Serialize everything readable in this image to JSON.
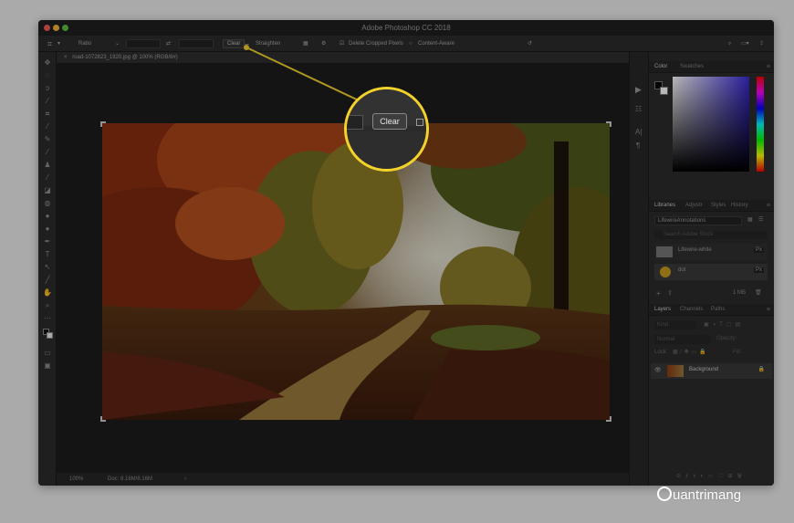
{
  "window": {
    "title": "Adobe Photoshop CC 2018"
  },
  "options_bar": {
    "ratio_label": "Ratio",
    "clear_label": "Clear",
    "straighten_label": "Straighten",
    "delete_cropped_label": "Delete Cropped Pixels",
    "content_aware_label": "Content-Aware"
  },
  "document": {
    "tab_label": "road-1072823_1920.jpg @ 100% (RGB/8#)",
    "zoom": "100%",
    "doc_info": "Doc: 8.16M/8.16M"
  },
  "callout": {
    "clear_label": "Clear",
    "accent_color": "#f3d22b"
  },
  "panels": {
    "color_tabs": [
      "Color",
      "Swatches"
    ],
    "library_tabs": [
      "Libraries",
      "Adjustr",
      "Styles",
      "History"
    ],
    "library_name": "LifewireAnnotations",
    "library_search_placeholder": "Search Adobe Stock",
    "library_items": [
      {
        "label": "Lifewire-white",
        "badge": "Px"
      },
      {
        "label": "dot",
        "badge": "Px"
      }
    ],
    "library_size": "1 MB",
    "layers_tabs": [
      "Layers",
      "Channels",
      "Paths"
    ],
    "layers_filter_placeholder": "Kind",
    "blend_mode": "Normal",
    "opacity_label": "Opacity:",
    "lock_label": "Lock:",
    "fill_label": "Fill:",
    "layer_name": "Background"
  },
  "watermark": {
    "text": "uantrimang"
  }
}
